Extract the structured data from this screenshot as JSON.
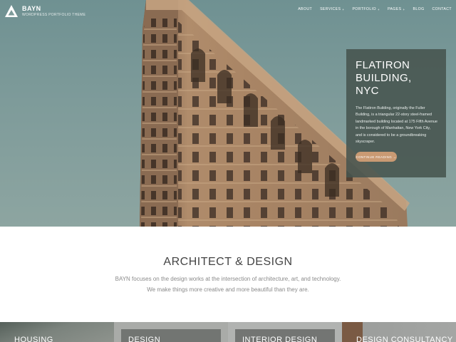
{
  "header": {
    "logo_title": "BAYN",
    "logo_subtitle": "WORDPRESS PORTFOLIO THEME",
    "nav": [
      {
        "label": "ABOUT",
        "has_submenu": false
      },
      {
        "label": "SERVICES",
        "has_submenu": true
      },
      {
        "label": "PORTFOLIO",
        "has_submenu": true
      },
      {
        "label": "PAGES",
        "has_submenu": true
      },
      {
        "label": "BLOG",
        "has_submenu": false
      },
      {
        "label": "CONTACT",
        "has_submenu": false
      }
    ],
    "submenu_caret": "+"
  },
  "hero": {
    "title_line1": "FLATIRON",
    "title_line2": "BUILDING, NYC",
    "description": "The Flatiron Building, originally the Fuller Building, is a triangular 22-story steel-framed landmarked building located at 175 Fifth Avenue in the borough of Manhattan, New York City, and is considered to be a groundbreaking skyscraper.",
    "button_label": "CONTINUE READING →"
  },
  "intro": {
    "title": "ARCHITECT & DESIGN",
    "line1": "BAYN focuses on the design works at the intersection of architecture, art, and technology.",
    "line2": "We make things more creative and more beautiful than they are."
  },
  "services": [
    {
      "label": "HOUSING"
    },
    {
      "label": "DESIGN"
    },
    {
      "label": "INTERIOR DESIGN"
    },
    {
      "label": "DESIGN CONSULTANCY"
    }
  ],
  "colors": {
    "sky": "#7e9b9a",
    "building": "#9a7a5e",
    "card_bg": "#47544f",
    "button": "#c99a73",
    "text_dark": "#444444",
    "text_muted": "#8a8a8a"
  }
}
